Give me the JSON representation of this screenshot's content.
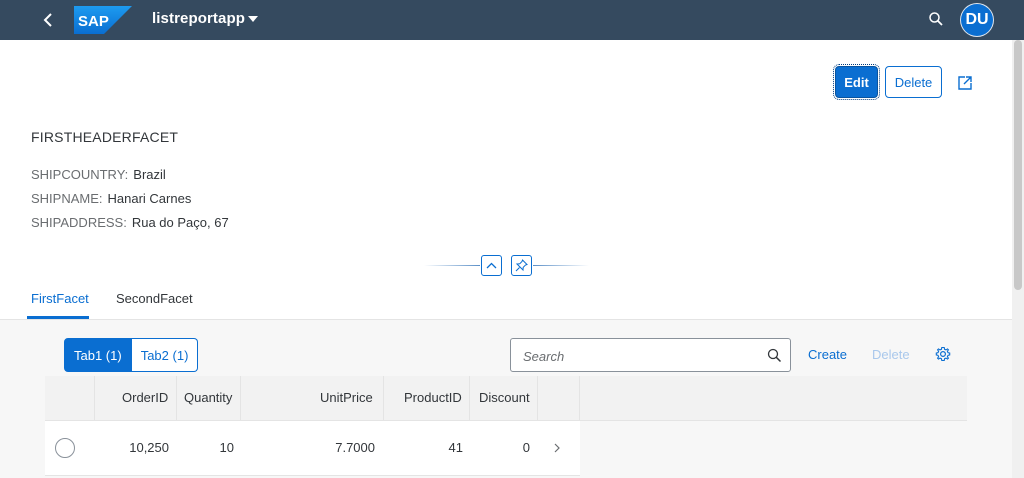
{
  "shell": {
    "app_title": "listreportapp",
    "avatar_initials": "DU",
    "brand_color": "#354a5f"
  },
  "header": {
    "edit_label": "Edit",
    "delete_label": "Delete",
    "facet_title": "FIRSTHEADERFACET",
    "fields": [
      {
        "label": "SHIPCOUNTRY:",
        "value": "Brazil"
      },
      {
        "label": "SHIPNAME:",
        "value": "Hanari Carnes"
      },
      {
        "label": "SHIPADDRESS:",
        "value": "Rua do Paço, 67"
      }
    ]
  },
  "tabs": [
    {
      "label": "FirstFacet",
      "active": true
    },
    {
      "label": "SecondFacet",
      "active": false
    }
  ],
  "table": {
    "segments": [
      {
        "label": "Tab1 (1)",
        "selected": true
      },
      {
        "label": "Tab2 (1)",
        "selected": false
      }
    ],
    "search_placeholder": "Search",
    "create_label": "Create",
    "delete_label": "Delete",
    "columns": [
      "OrderID",
      "Quantity",
      "UnitPrice",
      "ProductID",
      "Discount"
    ],
    "rows": [
      {
        "OrderID": "10,250",
        "Quantity": "10",
        "UnitPrice": "7.7000",
        "ProductID": "41",
        "Discount": "0"
      }
    ]
  },
  "colors": {
    "accent": "#0a6ed1",
    "text": "#32363a",
    "label": "#6a6d70"
  },
  "icons": [
    "back-icon",
    "sap-logo",
    "caret-down-icon",
    "search-icon",
    "share-icon",
    "collapse-icon",
    "pin-icon",
    "gear-icon",
    "chevron-right-icon"
  ]
}
